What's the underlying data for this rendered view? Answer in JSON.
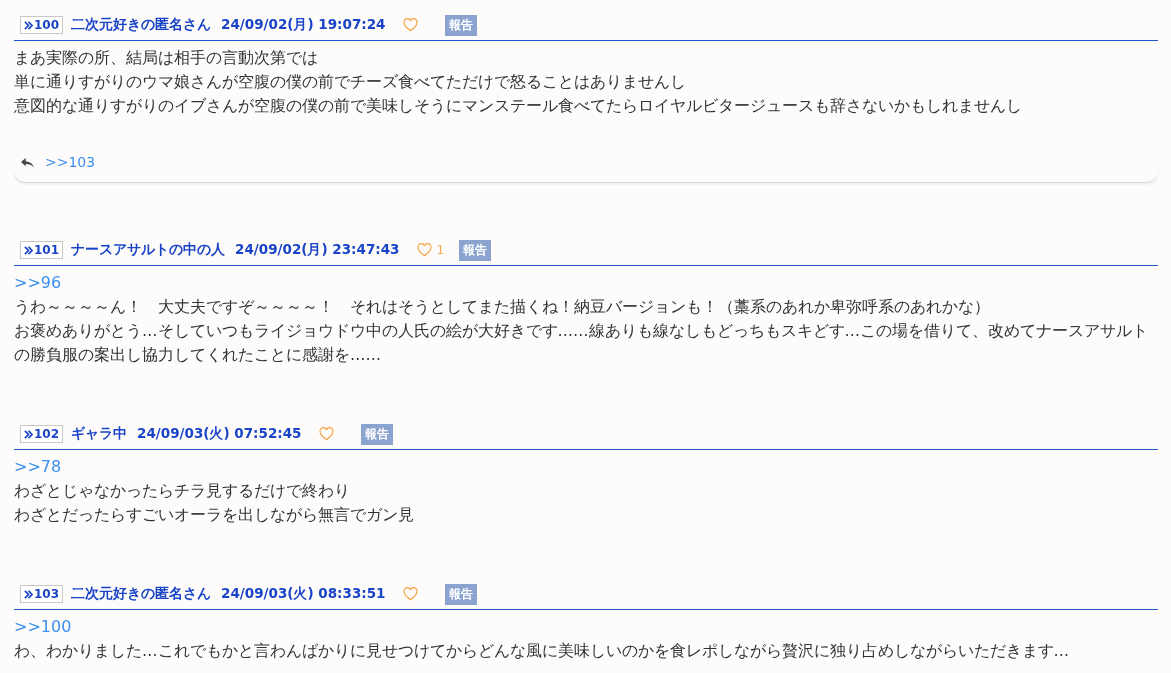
{
  "posts": [
    {
      "number": "100",
      "name": "二次元好きの匿名さん",
      "date": "24/09/02(月) 19:07:24",
      "report": "報告",
      "lines": [
        "まあ実際の所、結局は相手の言動次第では",
        "単に通りすがりのウマ娘さんが空腹の僕の前でチーズ食べてただけで怒ることはありませんし",
        "意図的な通りすがりのイブさんが空腹の僕の前で美味しそうにマンステール食べてたらロイヤルビタージュースも辞さないかもしれませんし"
      ],
      "replies": [
        ">>103"
      ]
    },
    {
      "number": "101",
      "name": "ナースアサルトの中の人",
      "date": "24/09/02(月) 23:47:43",
      "likes": "1",
      "report": "報告",
      "anchor": ">>96",
      "lines": [
        "うわ～～～～ん！　大丈夫ですぞ～～～～！　それはそうとしてまた描くね！納豆バージョンも！（藁系のあれか卑弥呼系のあれかな）",
        "お褒めありがとう…そしていつもライジョウドウ中の人氏の絵が大好きです……線ありも線なしもどっちもスキどす…この場を借りて、改めてナースアサルト",
        "の勝負服の案出し協力してくれたことに感謝を……"
      ]
    },
    {
      "number": "102",
      "name": "ギャラ中",
      "date": "24/09/03(火) 07:52:45",
      "report": "報告",
      "anchor": ">>78",
      "lines": [
        "わざとじゃなかったらチラ見するだけで終わり",
        "わざとだったらすごいオーラを出しながら無言でガン見"
      ]
    },
    {
      "number": "103",
      "name": "二次元好きの匿名さん",
      "date": "24/09/03(火) 08:33:51",
      "report": "報告",
      "anchor": ">>100",
      "lines": [
        "わ、わかりました…これでもかと言わんばかりに見せつけてからどんな風に美味しいのかを食レポしながら贅沢に独り占めしながらいただきます…"
      ]
    }
  ]
}
